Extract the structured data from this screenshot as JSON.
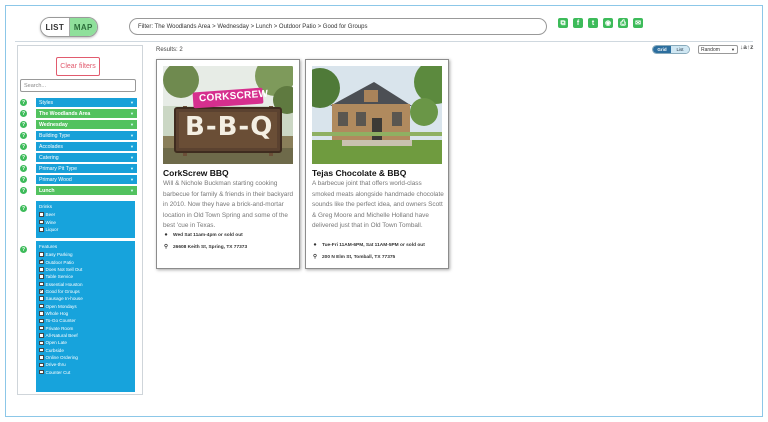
{
  "topbar": {
    "toggle_list": "LIST",
    "toggle_map": "MAP",
    "filter_text": "Filter: The Woodlands Area > Wednesday > Lunch > Outdoor Patio > Good for Groups",
    "share_icons": [
      "copy-icon",
      "facebook-icon",
      "twitter-icon",
      "reddit-icon",
      "print-icon",
      "email-icon"
    ]
  },
  "sidebar": {
    "clear_label": "Clear filters",
    "search_placeholder": "Search...",
    "filters": [
      {
        "label": "Styles",
        "state": "collapsed"
      },
      {
        "label": "The Woodlands Area",
        "state": "selected"
      },
      {
        "label": "Wednesday",
        "state": "selected"
      },
      {
        "label": "Building Type",
        "state": "collapsed"
      },
      {
        "label": "Accolades",
        "state": "collapsed"
      },
      {
        "label": "Catering",
        "state": "collapsed"
      },
      {
        "label": "Primary Pit Type",
        "state": "collapsed"
      },
      {
        "label": "Primary Wood",
        "state": "collapsed"
      },
      {
        "label": "Lunch",
        "state": "selected"
      }
    ],
    "drinks": {
      "title": "Drinks",
      "items": [
        {
          "label": "Beer",
          "checked": false
        },
        {
          "label": "Wine",
          "checked": false
        },
        {
          "label": "Liquor",
          "checked": false
        }
      ]
    },
    "features": {
      "title": "Features",
      "items": [
        {
          "label": "Easy Parking",
          "checked": false
        },
        {
          "label": "Outdoor Patio",
          "checked": true
        },
        {
          "label": "Does Not Sell Out",
          "checked": false
        },
        {
          "label": "Table Service",
          "checked": false
        },
        {
          "label": "Essential Houston",
          "checked": false
        },
        {
          "label": "Good for Groups",
          "checked": true
        },
        {
          "label": "Sausage In-house",
          "checked": false
        },
        {
          "label": "Open Mondays",
          "checked": false
        },
        {
          "label": "Whole Hog",
          "checked": false
        },
        {
          "label": "To-Go Counter",
          "checked": false
        },
        {
          "label": "Private Room",
          "checked": false
        },
        {
          "label": "All-Natural Beef",
          "checked": false
        },
        {
          "label": "Open Late",
          "checked": false
        },
        {
          "label": "Curbside",
          "checked": false
        },
        {
          "label": "Online Ordering",
          "checked": false
        },
        {
          "label": "Drive-thru",
          "checked": false
        },
        {
          "label": "Counter Cut",
          "checked": false
        }
      ]
    }
  },
  "results": {
    "label": "Results: 2",
    "view_grid": "Grid",
    "view_list": "List",
    "sort_value": "Random",
    "sort_icon": "↓a↑z"
  },
  "cards": [
    {
      "title": "CorkScrew BBQ",
      "description": "Will & Nichole Buckman starting cooking barbecue for family & friends in their backyard in 2010. Now they have a brick-and-mortar location in Old Town Spring and some of the best 'cue in Texas.",
      "hours": "Wed Sat 11am-4pm or sold out",
      "address": "26608 Keith St, Spring, TX 77373",
      "sign_top": "CORKSCREW",
      "sign_main": "B-B-Q"
    },
    {
      "title": "Tejas Chocolate & BBQ",
      "description": "A barbecue joint that offers world-class smoked meats alongside handmade chocolate sounds like the perfect idea, and owners Scott & Greg Moore and Michelle Holland have delivered just that in Old Town Tomball.",
      "hours": "Tue-Fri 11AM-6PM, Sat 11AM-5PM or sold out",
      "address": "200 N Elm St, Tomball, TX 77375"
    }
  ],
  "colors": {
    "accent_green": "#3dbb5a",
    "filter_blue": "#18a0d8",
    "filter_green": "#52c25f",
    "clear_red": "#e15b6e"
  }
}
